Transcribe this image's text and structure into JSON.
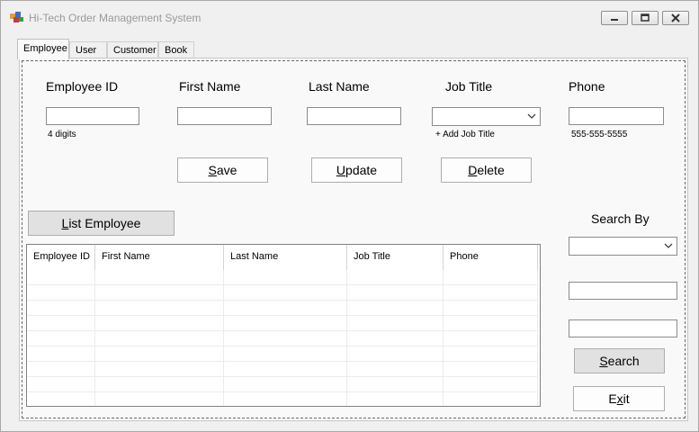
{
  "window": {
    "title": "Hi-Tech Order Management System",
    "minimize_icon": "minimize-icon",
    "restore_icon": "restore-icon",
    "close_icon": "close-icon"
  },
  "tabs": [
    {
      "label": "Employee",
      "active": true
    },
    {
      "label": "User",
      "active": false
    },
    {
      "label": "Customer",
      "active": false
    },
    {
      "label": "Book",
      "active": false
    }
  ],
  "form": {
    "employee_id_label": "Employee ID",
    "first_name_label": "First Name",
    "last_name_label": "Last Name",
    "job_title_label": "Job Title",
    "phone_label": "Phone",
    "employee_id_value": "",
    "first_name_value": "",
    "last_name_value": "",
    "job_title_value": "",
    "phone_value": "",
    "employee_id_hint": "4 digits",
    "add_job_title_link": "+ Add Job Title",
    "phone_hint": "555-555-5555"
  },
  "buttons": {
    "save_ul": "S",
    "save_rest": "ave",
    "update_ul": "U",
    "update_rest": "pdate",
    "delete_ul": "D",
    "delete_rest": "elete",
    "list_ul": "L",
    "list_rest": "ist Employee",
    "search_ul": "S",
    "search_rest": "earch",
    "exit_pre": "E",
    "exit_ul": "x",
    "exit_rest": "it"
  },
  "search": {
    "label": "Search By",
    "by_value": "",
    "input1_value": "",
    "input2_value": ""
  },
  "grid": {
    "columns": [
      "Employee ID",
      "First Name",
      "Last Name",
      "Job Title",
      "Phone"
    ],
    "rows": []
  },
  "colors": {
    "window_bg": "#f0f0f0",
    "panel_bg": "#f9f9f9",
    "button_gray": "#e1e1e1"
  }
}
